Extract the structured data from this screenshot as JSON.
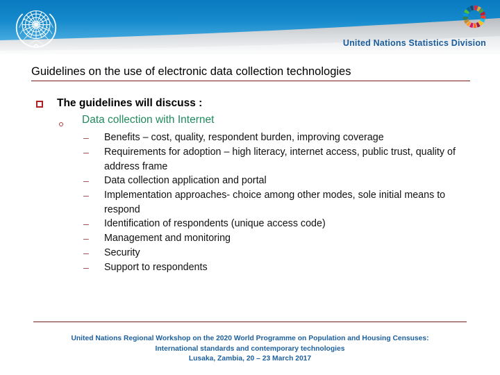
{
  "header": {
    "division_name": "United Nations Statistics Division",
    "un_emblem_icon": "un-emblem-icon",
    "sdg_wheel_icon": "sdg-wheel-icon",
    "banner_color_top": "#0b7bc1",
    "banner_color_bottom": "#bcdff2"
  },
  "slide": {
    "title": "Guidelines on the use of electronic data collection technologies",
    "title_rule_color": "#7b1c1c",
    "level1": {
      "bullet_icon": "square-bullet-icon",
      "bullet_color": "#b01f24",
      "text": "The guidelines will discuss :"
    },
    "level2": {
      "bullet_icon": "circle-bullet-icon",
      "bullet_color": "#a33a3a",
      "text_color": "#1f8a5e",
      "text": "Data collection with Internet"
    },
    "level3": {
      "bullet_icon": "dash-bullet-icon",
      "bullet_glyph": "–",
      "bullet_color": "#a0484c",
      "items": [
        "Benefits – cost, quality, respondent burden, improving coverage",
        "Requirements for adoption – high literacy, internet access, public trust, quality of address frame",
        "Data collection application and portal",
        "Implementation approaches- choice among other modes, sole initial means to respond",
        "Identification of respondents (unique access code)",
        "Management and monitoring",
        "Security",
        "Support to respondents"
      ]
    }
  },
  "footer": {
    "rule_color": "#6e1c1c",
    "text_color": "#1c5f9d",
    "lines": [
      "United Nations Regional Workshop on the 2020 World Programme on Population and Housing Censuses:",
      "International standards and contemporary technologies",
      "Lusaka, Zambia, 20 – 23 March 2017"
    ]
  }
}
